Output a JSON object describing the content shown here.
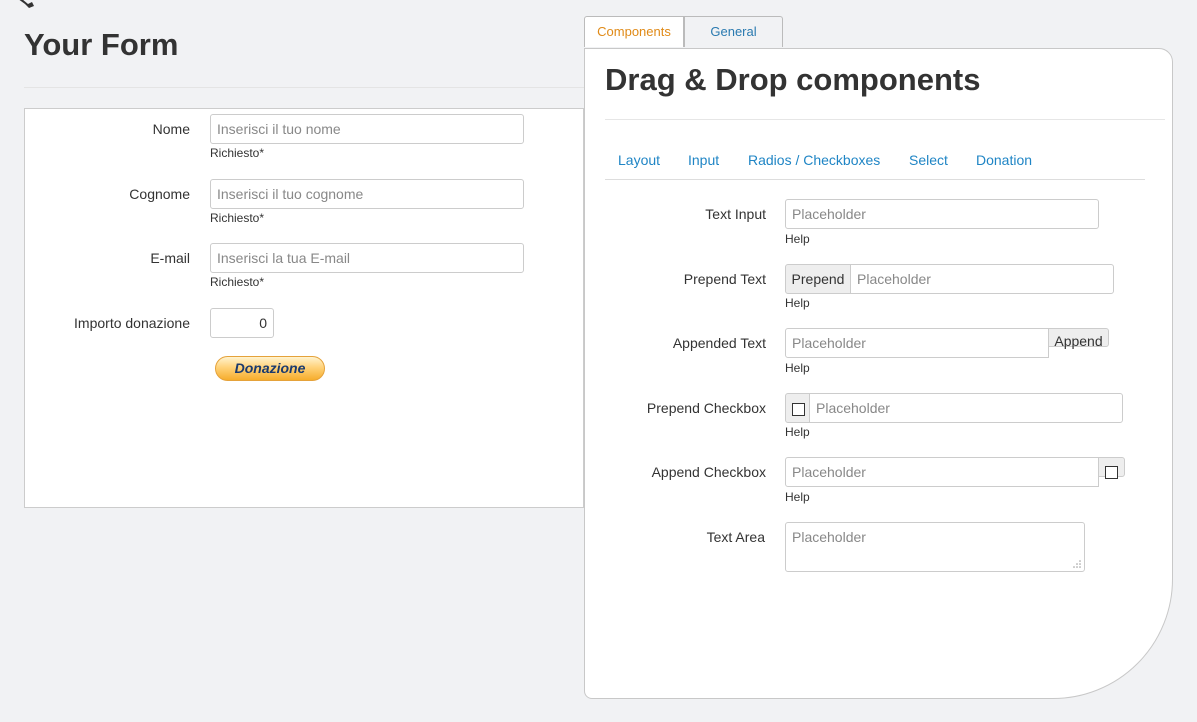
{
  "form": {
    "title": "Your Form",
    "fields": [
      {
        "label": "Nome",
        "placeholder": "Inserisci il tuo nome",
        "help": "Richiesto*"
      },
      {
        "label": "Cognome",
        "placeholder": "Inserisci il tuo cognome",
        "help": "Richiesto*"
      },
      {
        "label": "E-mail",
        "placeholder": "Inserisci la tua E-mail",
        "help": "Richiesto*"
      }
    ],
    "amount": {
      "label": "Importo donazione",
      "value": "0"
    },
    "donate_label": "Donazione"
  },
  "tabs": [
    {
      "label": "Components",
      "active": true
    },
    {
      "label": "General",
      "active": false
    }
  ],
  "panel": {
    "title": "Drag & Drop components",
    "subnav": [
      "Layout",
      "Input",
      "Radios / Checkboxes",
      "Select",
      "Donation"
    ],
    "components": {
      "text_input": {
        "label": "Text Input",
        "placeholder": "Placeholder",
        "help": "Help"
      },
      "prepend_text": {
        "label": "Prepend Text",
        "addon": "Prepend",
        "placeholder": "Placeholder",
        "help": "Help"
      },
      "appended_text": {
        "label": "Appended Text",
        "placeholder": "Placeholder",
        "addon": "Append",
        "help": "Help"
      },
      "prepend_checkbox": {
        "label": "Prepend Checkbox",
        "placeholder": "Placeholder",
        "help": "Help"
      },
      "append_checkbox": {
        "label": "Append Checkbox",
        "placeholder": "Placeholder",
        "help": "Help"
      },
      "text_area": {
        "label": "Text Area",
        "placeholder": "Placeholder"
      }
    }
  },
  "colors": {
    "link": "#1f85c5",
    "active_tab": "#e08a17",
    "page_bg": "#f1f2f4",
    "donate_text": "#1a3a6e"
  },
  "icons": {
    "corner": "wrench-icon",
    "resize": "resize-grip-icon"
  }
}
